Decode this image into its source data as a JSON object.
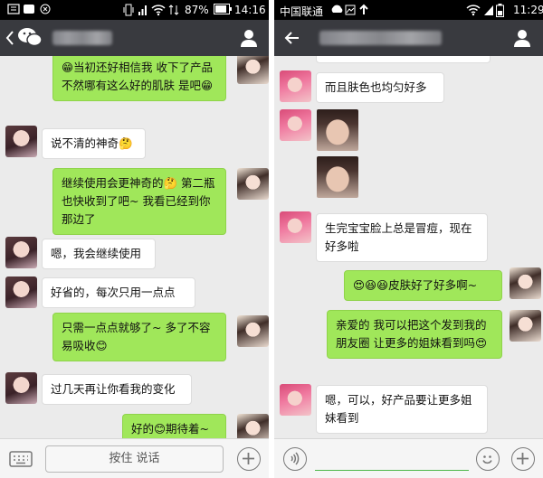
{
  "left": {
    "status": {
      "battery": "87%",
      "time": "14:16"
    },
    "bottom": {
      "hold_to_talk": "按住 说话"
    },
    "messages": [
      {
        "side": "me",
        "text": "😁当初还好相信我 收下了产品 不然哪有这么好的肌肤 是吧😁"
      },
      {
        "side": "her",
        "text": "说不清的神奇🤔"
      },
      {
        "side": "me",
        "text": "继续使用会更神奇的🤔 第二瓶也快收到了吧~ 我看已经到你那边了"
      },
      {
        "side": "her",
        "text": "嗯，我会继续使用"
      },
      {
        "side": "her",
        "text": "好省的，每次只用一点点"
      },
      {
        "side": "me",
        "text": "只需一点点就够了~ 多了不容易吸收😊"
      },
      {
        "side": "her",
        "text": "过几天再让你看我的变化"
      },
      {
        "side": "me",
        "text": "好的😊期待着~"
      }
    ]
  },
  "right": {
    "status": {
      "carrier": "中国联通",
      "time": "11:29"
    },
    "messages": [
      {
        "side": "her",
        "text": "而且肤色也均匀好多"
      },
      {
        "side": "her",
        "text": "生完宝宝脸上总是冒痘，现在好多啦"
      },
      {
        "side": "me",
        "text": "😍😆😆皮肤好了好多啊~"
      },
      {
        "side": "me",
        "text": "亲爱的 我可以把这个发到我的朋友圈 让更多的姐妹看到吗😍"
      },
      {
        "side": "her",
        "text": "嗯，可以，好产品要让更多姐妹看到"
      }
    ]
  },
  "colors": {
    "bubble_green": "#a0e75a",
    "title_bar": "#393a3f",
    "chat_background": "#ebebeb"
  },
  "icons": [
    "back-icon",
    "wechat-logo-icon",
    "contact-icon",
    "keyboard-icon",
    "voice-icon",
    "emoji-icon",
    "plus-icon",
    "signal-icon",
    "wifi-icon",
    "battery-icon"
  ]
}
